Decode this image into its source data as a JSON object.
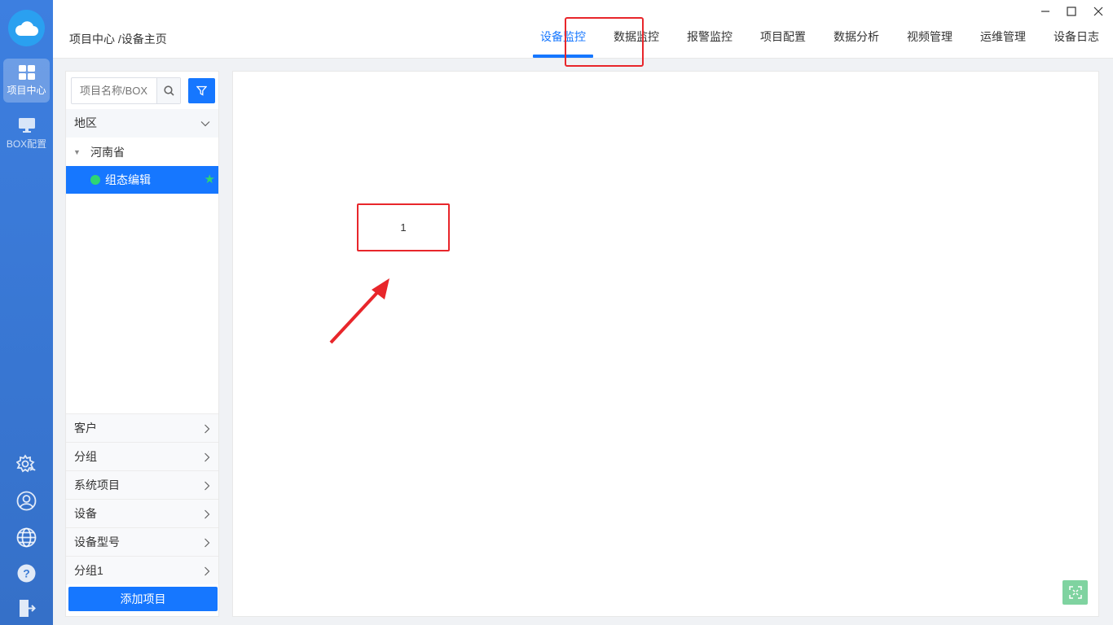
{
  "rail": {
    "items": [
      {
        "label": "项目中心",
        "icon": "grid-icon"
      },
      {
        "label": "BOX配置",
        "icon": "monitor-icon"
      }
    ],
    "bottom_icons": [
      "settings-wifi-icon",
      "user-icon",
      "globe-icon",
      "help-icon",
      "logout-icon"
    ]
  },
  "header": {
    "breadcrumb": "项目中心 /设备主页",
    "tabs": [
      {
        "label": "设备监控",
        "active": true
      },
      {
        "label": "数据监控"
      },
      {
        "label": "报警监控"
      },
      {
        "label": "项目配置"
      },
      {
        "label": "数据分析"
      },
      {
        "label": "视频管理"
      },
      {
        "label": "运维管理"
      },
      {
        "label": "设备日志"
      }
    ]
  },
  "sidebar": {
    "search_placeholder": "项目名称/BOX",
    "region_header": "地区",
    "tree": {
      "province": "河南省",
      "project": "组态编辑"
    },
    "categories": [
      "客户",
      "分组",
      "系统项目",
      "设备",
      "设备型号",
      "分组1"
    ],
    "add_button": "添加项目"
  },
  "canvas": {
    "widget_text": "1"
  },
  "colors": {
    "accent": "#1677ff",
    "rail": "#3a7bd5",
    "highlight": "#e8262b",
    "online": "#2ed573"
  }
}
